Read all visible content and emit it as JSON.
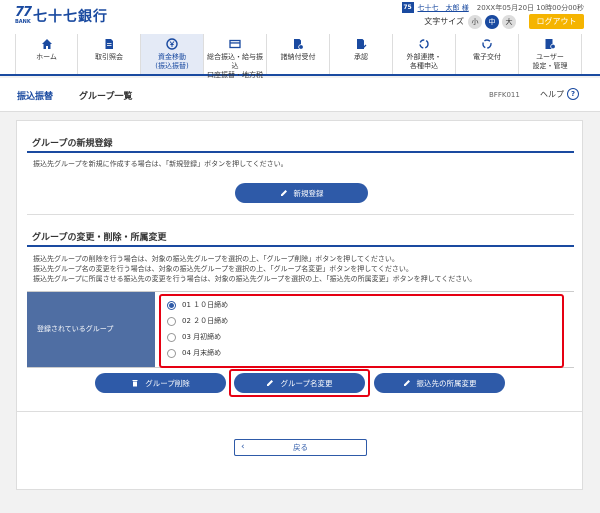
{
  "header": {
    "logo_mark": "77",
    "logo_bank": "BANK",
    "logo_text": "七十七銀行",
    "user_icon": "75",
    "user_name": "七十七　太郎 様",
    "login_time": "20XX年05月20日 10時00分00秒",
    "font_size_label": "文字サイズ",
    "font_sizes": [
      "小",
      "中",
      "大"
    ],
    "font_size_selected": "中",
    "logout_label": "ログアウト"
  },
  "nav": {
    "items": [
      {
        "label1": "ホーム",
        "label2": "",
        "icon": "home-icon"
      },
      {
        "label1": "取引照会",
        "label2": "",
        "icon": "document-icon"
      },
      {
        "label1": "資金移動",
        "label2": "(振込振替)",
        "icon": "yen-transfer-icon",
        "active": true
      },
      {
        "label1": "総合振込・給与振込",
        "label2": "口座振替・地方税",
        "icon": "card-icon"
      },
      {
        "label1": "諸納付受付",
        "label2": "",
        "icon": "person-doc-icon"
      },
      {
        "label1": "承認",
        "label2": "",
        "icon": "approval-icon"
      },
      {
        "label1": "外部連携・",
        "label2": "各種申込",
        "icon": "link-icon"
      },
      {
        "label1": "電子交付",
        "label2": "",
        "icon": "refresh-icon"
      },
      {
        "label1": "ユーザー",
        "label2": "設定・管理",
        "icon": "user-settings-icon"
      }
    ]
  },
  "titlebar": {
    "breadcrumb_parent": "振込振替",
    "page_title": "グループ一覧",
    "screen_id": "BFFK011",
    "help_label": "ヘルプ",
    "help_icon": "?"
  },
  "new_section": {
    "title": "グループの新規登録",
    "description": "振込先グループを新規に作成する場合は、「新規登録」ボタンを押してください。",
    "button_label": "新規登録"
  },
  "edit_section": {
    "title": "グループの変更・削除・所属変更",
    "descriptions": [
      "振込先グループの削除を行う場合は、対象の振込先グループを選択の上、「グループ削除」ボタンを押してください。",
      "振込先グループ名の変更を行う場合は、対象の振込先グループを選択の上、「グループ名変更」ボタンを押してください。",
      "振込先グループに所属させる振込先の変更を行う場合は、対象の振込先グループを選択の上、「振込先の所属変更」ボタンを押してください。"
    ],
    "table_label": "登録されているグループ",
    "groups": [
      {
        "label": "01 １０日締め",
        "checked": true
      },
      {
        "label": "02 ２０日締め",
        "checked": false
      },
      {
        "label": "03 月初締め",
        "checked": false
      },
      {
        "label": "04 月末締め",
        "checked": false
      }
    ],
    "delete_label": "グループ削除",
    "rename_label": "グループ名変更",
    "member_change_label": "振込先の所属変更"
  },
  "back_label": "戻る",
  "colors": {
    "primary": "#2e5aa8",
    "brand": "#1a4aa0",
    "highlight": "#e60012",
    "logout": "#f5b400"
  }
}
